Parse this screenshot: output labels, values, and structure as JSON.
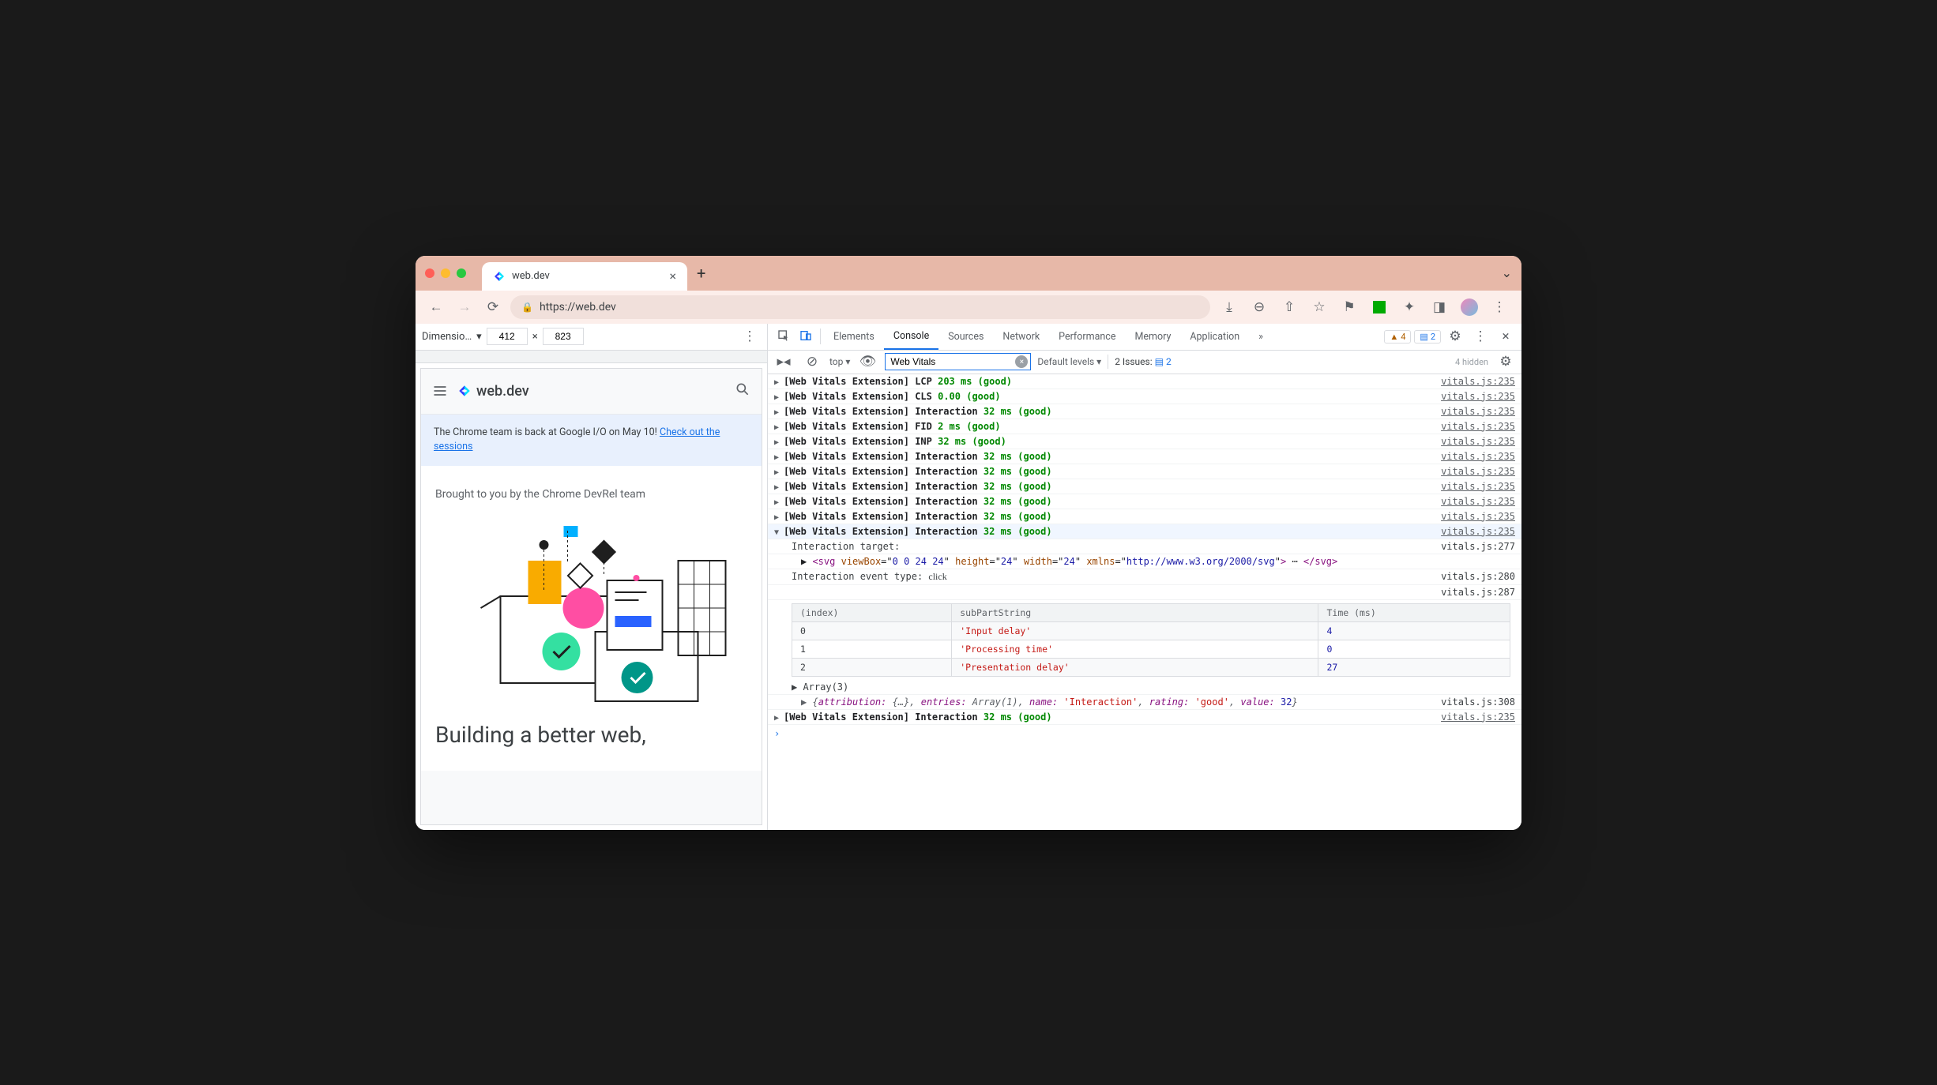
{
  "browser": {
    "tab_title": "web.dev",
    "url": "https://web.dev",
    "plus": "+"
  },
  "device_toolbar": {
    "label": "Dimensio…",
    "width": "412",
    "times": "×",
    "height": "823"
  },
  "mobile": {
    "brand": "web.dev",
    "banner_prefix": "The Chrome team is back at Google I/O on May 10! ",
    "banner_link": "Check out the sessions",
    "brought": "Brought to you by the Chrome DevRel team",
    "hero_title": "Building a better web,"
  },
  "devtools": {
    "tabs": [
      "Elements",
      "Console",
      "Sources",
      "Network",
      "Performance",
      "Memory",
      "Application"
    ],
    "active_tab": "Console",
    "more": "»",
    "warn_count": "4",
    "info_count": "2",
    "toolbar": {
      "top": "top",
      "filter": "Web Vitals",
      "levels": "Default levels",
      "issues_label": "2 Issues:",
      "issues_count": "2",
      "hidden": "4 hidden"
    },
    "logs": [
      {
        "m": "LCP",
        "v": "203 ms (good)",
        "src": "vitals.js:235"
      },
      {
        "m": "CLS",
        "v": "0.00 (good)",
        "src": "vitals.js:235"
      },
      {
        "m": "Interaction",
        "v": "32 ms (good)",
        "src": "vitals.js:235"
      },
      {
        "m": "FID",
        "v": "2 ms (good)",
        "src": "vitals.js:235"
      },
      {
        "m": "INP",
        "v": "32 ms (good)",
        "src": "vitals.js:235"
      },
      {
        "m": "Interaction",
        "v": "32 ms (good)",
        "src": "vitals.js:235"
      },
      {
        "m": "Interaction",
        "v": "32 ms (good)",
        "src": "vitals.js:235"
      },
      {
        "m": "Interaction",
        "v": "32 ms (good)",
        "src": "vitals.js:235"
      },
      {
        "m": "Interaction",
        "v": "32 ms (good)",
        "src": "vitals.js:235"
      },
      {
        "m": "Interaction",
        "v": "32 ms (good)",
        "src": "vitals.js:235"
      }
    ],
    "expanded": {
      "m": "Interaction",
      "v": "32 ms (good)",
      "src": "vitals.js:235"
    },
    "detail": {
      "target_label": "Interaction target:",
      "target_src": "vitals.js:277",
      "svg_viewbox": "0 0 24 24",
      "svg_h": "24",
      "svg_w": "24",
      "svg_ns": "http://www.w3.org/2000/svg",
      "event_label": "Interaction event type: ",
      "event_type": "click",
      "event_src": "vitals.js:280",
      "table_src": "vitals.js:287",
      "cols": [
        "(index)",
        "subPartString",
        "Time (ms)"
      ],
      "rows": [
        {
          "i": "0",
          "s": "'Input delay'",
          "t": "4"
        },
        {
          "i": "1",
          "s": "'Processing time'",
          "t": "0"
        },
        {
          "i": "2",
          "s": "'Presentation delay'",
          "t": "27"
        }
      ],
      "array_label": "Array(3)",
      "obj": {
        "attr": "attribution:",
        "av": "{…}",
        "entries": "entries:",
        "ev": "Array(1)",
        "name": "name:",
        "nv": "'Interaction'",
        "rating": "rating:",
        "rv": "'good'",
        "value": "value:",
        "vv": "32"
      },
      "obj_src": "vitals.js:308"
    },
    "trailing": {
      "m": "Interaction",
      "v": "32 ms (good)",
      "src": "vitals.js:235"
    },
    "prefix": "[Web Vitals Extension]"
  }
}
